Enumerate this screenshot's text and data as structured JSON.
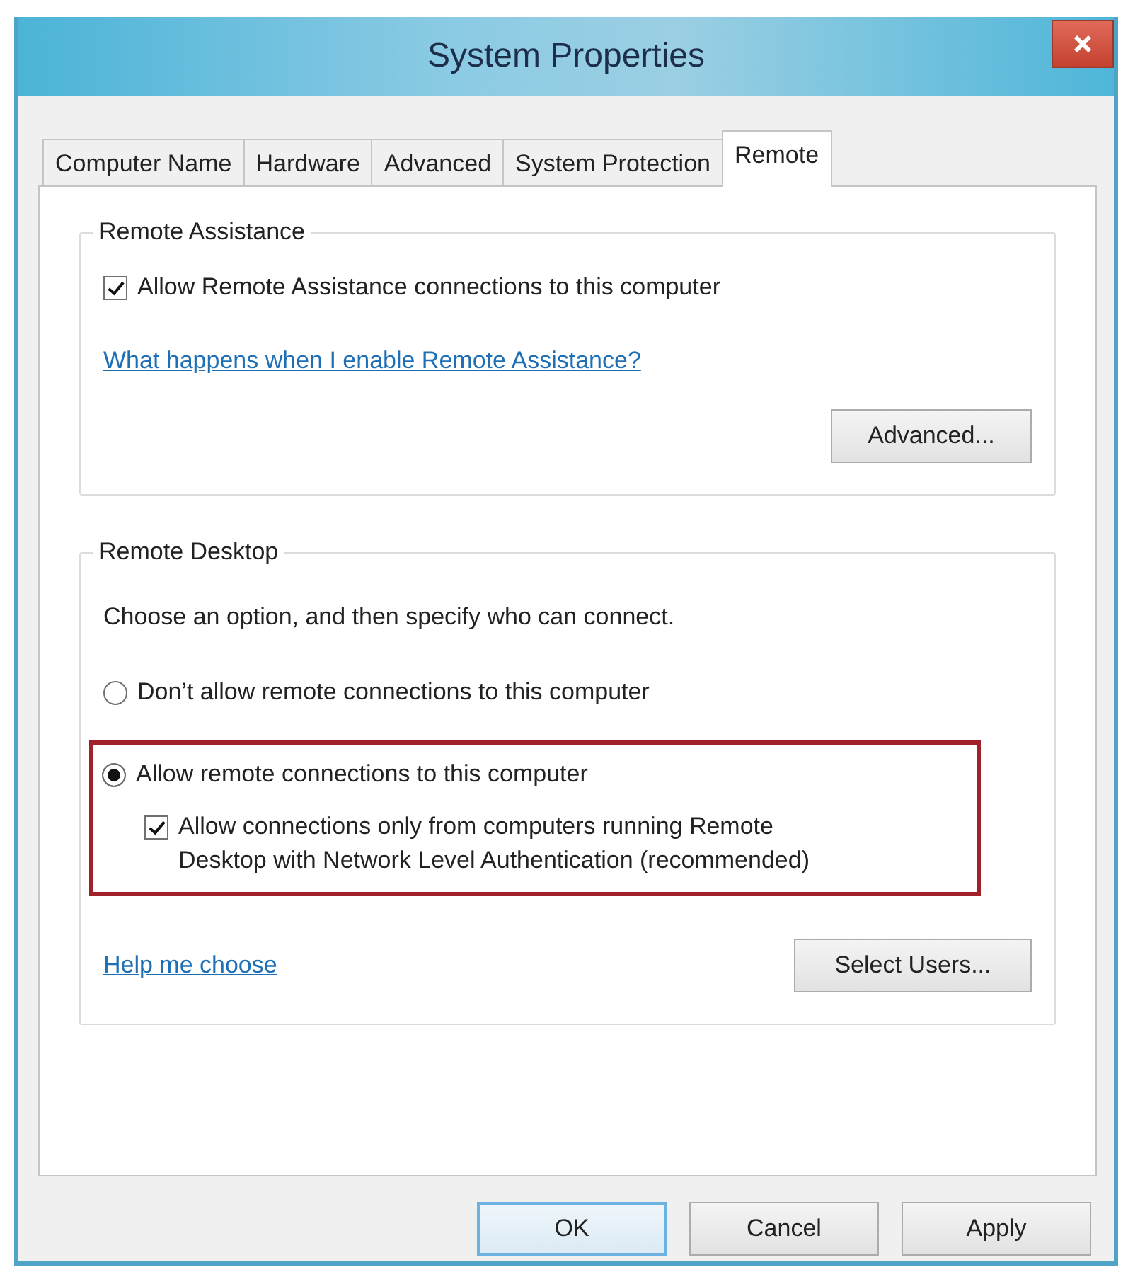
{
  "window": {
    "title": "System Properties"
  },
  "tabs": [
    {
      "label": "Computer Name",
      "selected": false
    },
    {
      "label": "Hardware",
      "selected": false
    },
    {
      "label": "Advanced",
      "selected": false
    },
    {
      "label": "System Protection",
      "selected": false
    },
    {
      "label": "Remote",
      "selected": true
    }
  ],
  "remote_assistance": {
    "title": "Remote Assistance",
    "checkbox": {
      "label": "Allow Remote Assistance connections to this computer",
      "checked": true
    },
    "link": "What happens when I enable Remote Assistance?",
    "button": "Advanced..."
  },
  "remote_desktop": {
    "title": "Remote Desktop",
    "instruction": "Choose an option, and then specify who can connect.",
    "options": [
      {
        "label": "Don’t allow remote connections to this computer",
        "selected": false
      },
      {
        "label": "Allow remote connections to this computer",
        "selected": true
      }
    ],
    "highlighted": true,
    "nla_checkbox": {
      "label": "Allow connections only from computers running Remote Desktop with Network Level Authentication (recommended)",
      "checked": true
    },
    "link": "Help me choose",
    "button": "Select Users..."
  },
  "buttons": [
    {
      "label": "OK",
      "default": true
    },
    {
      "label": "Cancel",
      "default": false
    },
    {
      "label": "Apply",
      "default": false
    }
  ]
}
